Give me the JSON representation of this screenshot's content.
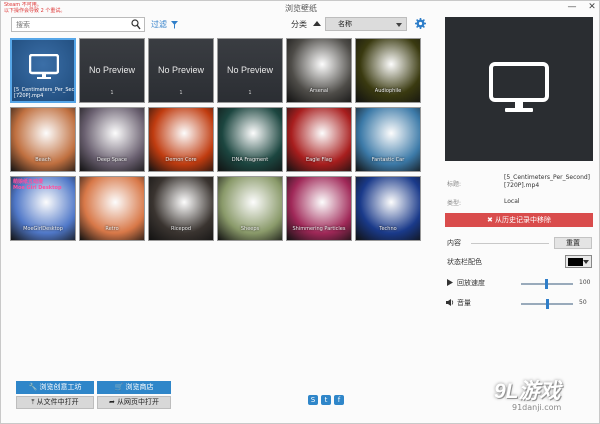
{
  "window": {
    "title": "浏览壁纸",
    "warning": "Steam 不可用。\n以下操作会导致 2 个重试。"
  },
  "toolbar": {
    "search_placeholder": "搜索",
    "filter_label": "过滤",
    "sort_label": "分类",
    "sort_value": "名称"
  },
  "tiles": [
    {
      "kind": "selected",
      "filename": "[5_Centimeters_Per_Second][720P].mp4",
      "bg": "#1e4a7a"
    },
    {
      "kind": "nopreview",
      "np": "No Preview",
      "num": "1"
    },
    {
      "kind": "nopreview",
      "np": "No Preview",
      "num": "1"
    },
    {
      "kind": "nopreview",
      "np": "No Preview",
      "num": "1"
    },
    {
      "kind": "image",
      "caption": "Arsenal",
      "bg": "#4e4c48"
    },
    {
      "kind": "image",
      "caption": "Audiophile",
      "bg": "#3a3a10"
    },
    {
      "kind": "image",
      "caption": "Beach",
      "bg": "#c07040"
    },
    {
      "kind": "image",
      "caption": "Deep Space",
      "bg": "#6a6070"
    },
    {
      "kind": "image",
      "caption": "Demon Core",
      "bg": "#c03c10"
    },
    {
      "kind": "image",
      "caption": "DNA Fragment",
      "bg": "#1c4640"
    },
    {
      "kind": "image",
      "caption": "Eagle Flag",
      "bg": "#a81e1e"
    },
    {
      "kind": "image",
      "caption": "Fantastic Car",
      "bg": "#3c7aa8"
    },
    {
      "kind": "image",
      "caption": "MoeGirlDesktop",
      "moe": "萌娘纸五动漫\nMoe Girl Desktop",
      "bg": "#5078c8"
    },
    {
      "kind": "image",
      "caption": "Retro",
      "bg": "#d87848"
    },
    {
      "kind": "image",
      "caption": "Ricepod",
      "bg": "#3a3430"
    },
    {
      "kind": "image",
      "caption": "Sheeps",
      "bg": "#8a9a6a"
    },
    {
      "kind": "image",
      "caption": "Shimmering Particles",
      "bg": "#a02858"
    },
    {
      "kind": "image",
      "caption": "Techno",
      "bg": "#1a3a8a"
    }
  ],
  "details": {
    "title_label": "标题:",
    "title_value": "[5_Centimeters_Per_Second][720P].mp4",
    "type_label": "类型:",
    "type_value": "Local",
    "remove_label": "✖ 从历史记录中移除",
    "content_label": "内容",
    "reset_label": "重置",
    "statusbar_color_label": "状态栏配色",
    "statusbar_color": "#000000",
    "speed_label": "回放速度",
    "speed_value": "100",
    "volume_label": "音量",
    "volume_value": "50"
  },
  "bottom": {
    "workshop": "浏览创意工坊",
    "store": "浏览商店",
    "open_file": "从文件中打开",
    "open_web": "从网页中打开"
  },
  "watermark": {
    "big": "9L游戏",
    "url": "91danji.com"
  }
}
